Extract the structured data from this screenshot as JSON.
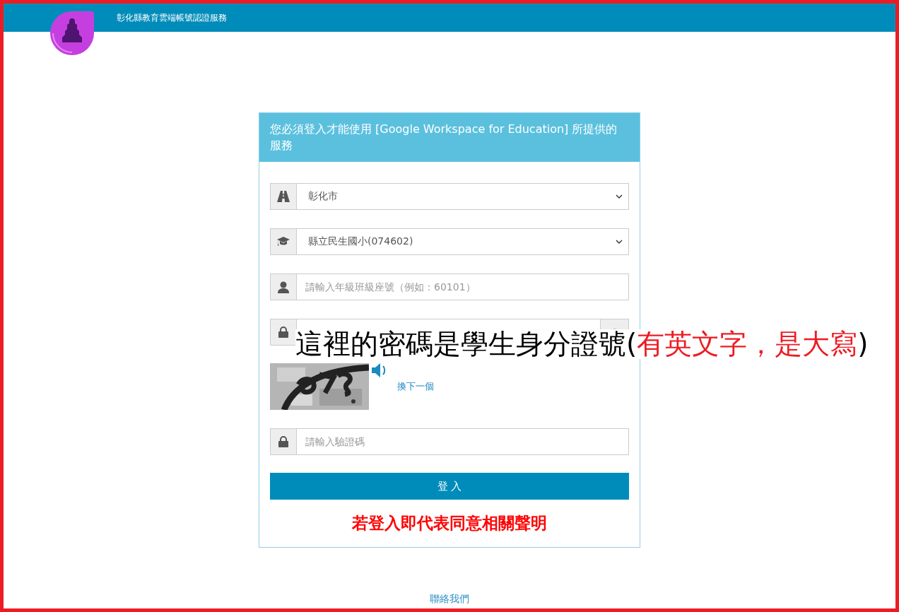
{
  "header": {
    "title": "彰化縣教育雲端帳號認證服務"
  },
  "login": {
    "heading": "您必須登入才能使用 [Google Workspace for Education] 所提供的服務",
    "fields": [
      {
        "kind": "select",
        "value": "彰化市"
      },
      {
        "kind": "select",
        "value": "縣立民生國小(074602)"
      },
      {
        "kind": "text",
        "placeholder": "請輸入年級班級座號（例如：60101）"
      },
      {
        "kind": "password"
      }
    ],
    "captcha": {
      "refresh_link": "換下一個"
    },
    "captcha_field": {
      "placeholder": "請輸入驗證碼"
    },
    "submit": "登 入",
    "notice": "若登入即代表同意相關聲明"
  },
  "annotation": {
    "parts": [
      {
        "text": "這裡的密碼是學生身分證號(",
        "color": "#000000"
      },
      {
        "text": "有英文字，是大寫",
        "color": "#ed1c24"
      },
      {
        "text": ")",
        "color": "#000000"
      }
    ]
  },
  "footer": {
    "link": "聯絡我們"
  }
}
